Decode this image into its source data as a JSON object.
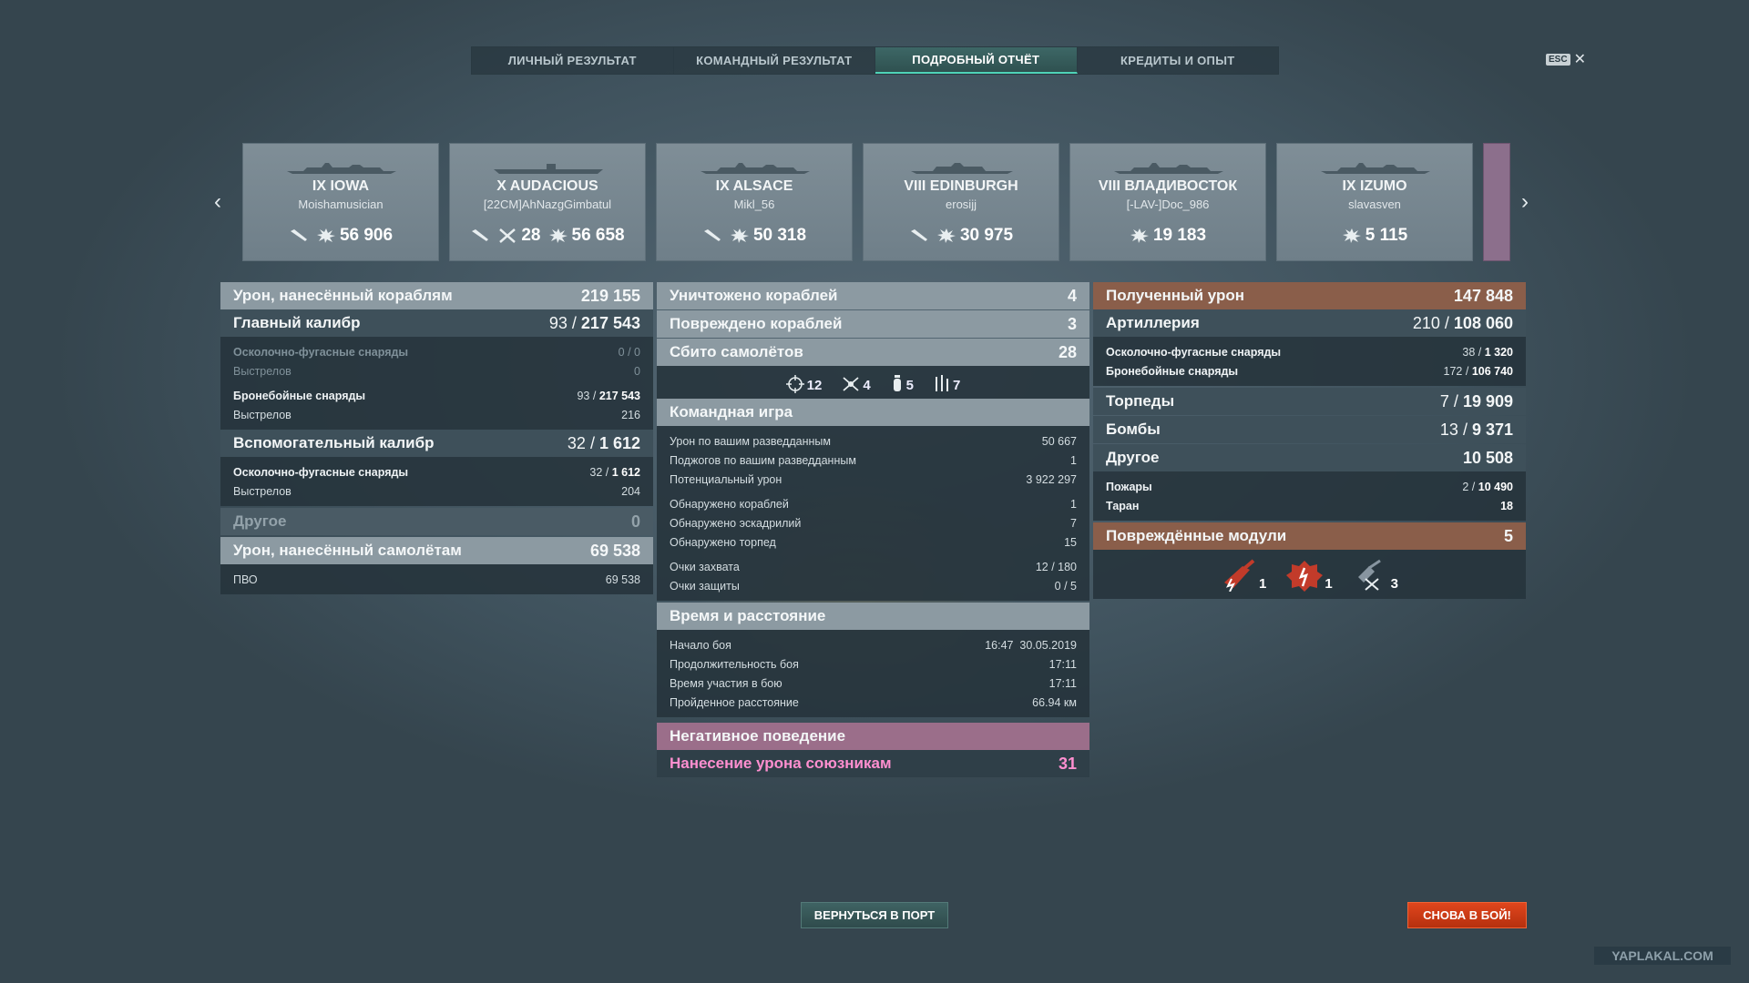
{
  "tabs": [
    {
      "label": "ЛИЧНЫЙ РЕЗУЛЬТАТ"
    },
    {
      "label": "КОМАНДНЫЙ РЕЗУЛЬТАТ"
    },
    {
      "label": "ПОДРОБНЫЙ ОТЧЁТ"
    },
    {
      "label": "КРЕДИТЫ И ОПЫТ"
    }
  ],
  "esc_label": "ESC",
  "ships": [
    {
      "name": "IX IOWA",
      "player": "Moishamusician",
      "kills": "",
      "damage": "56 906"
    },
    {
      "name": "X AUDACIOUS",
      "player": "[22CM]AhNazgGimbatul",
      "kills": "28",
      "damage": "56 658"
    },
    {
      "name": "IX ALSACE",
      "player": "Mikl_56",
      "kills": "",
      "damage": "50 318"
    },
    {
      "name": "VIII EDINBURGH",
      "player": "erosijj",
      "kills": "",
      "damage": "30 975"
    },
    {
      "name": "VIII ВЛАДИВОСТОК",
      "player": "[-LAV-]Doc_986",
      "kills": "",
      "damage": "19 183"
    },
    {
      "name": "IX IZUMO",
      "player": "slavasven",
      "kills": "",
      "damage": "5 115"
    }
  ],
  "left": {
    "ship_damage": {
      "label": "Урон, нанесённый кораблям",
      "value": "219 155"
    },
    "main": {
      "label": "Главный калибр",
      "hits": "93",
      "dmg": "217 543"
    },
    "main_he": {
      "label": "Осколочно-фугасные снаряды",
      "value": "0 / 0"
    },
    "main_he_shots": {
      "label": "Выстрелов",
      "value": "0"
    },
    "main_ap": {
      "label": "Бронебойные снаряды",
      "hits": "93 /",
      "dmg": "217 543"
    },
    "main_ap_shots": {
      "label": "Выстрелов",
      "value": "216"
    },
    "secondary": {
      "label": "Вспомогательный калибр",
      "hits": "32",
      "dmg": "1 612"
    },
    "sec_he": {
      "label": "Осколочно-фугасные снаряды",
      "hits": "32 /",
      "dmg": "1 612"
    },
    "sec_he_shots": {
      "label": "Выстрелов",
      "value": "204"
    },
    "other": {
      "label": "Другое",
      "value": "0"
    },
    "plane_damage": {
      "label": "Урон, нанесённый самолётам",
      "value": "69 538"
    },
    "aa": {
      "label": "ПВО",
      "value": "69 538"
    }
  },
  "center": {
    "destroyed": {
      "label": "Уничтожено кораблей",
      "value": "4"
    },
    "damaged": {
      "label": "Повреждено кораблей",
      "value": "3"
    },
    "planes": {
      "label": "Сбито самолётов",
      "value": "28"
    },
    "plane_types": [
      {
        "icon": "crosshair-icon",
        "value": "12"
      },
      {
        "icon": "fighter-icon",
        "value": "4"
      },
      {
        "icon": "bomb-icon",
        "value": "5"
      },
      {
        "icon": "rocket-icon",
        "value": "7"
      }
    ],
    "team": {
      "label": "Командная игра",
      "lines": [
        {
          "k": "Урон по вашим разведданным",
          "v": "50 667"
        },
        {
          "k": "Поджогов по вашим разведданным",
          "v": "1"
        },
        {
          "k": "Потенциальный урон",
          "v": "3 922 297"
        },
        {
          "k": "Обнаружено кораблей",
          "v": "1"
        },
        {
          "k": "Обнаружено эскадрилий",
          "v": "7"
        },
        {
          "k": "Обнаружено торпед",
          "v": "15"
        },
        {
          "k": "Очки захвата",
          "v": "12 / 180"
        },
        {
          "k": "Очки защиты",
          "v": "0 / 5"
        }
      ]
    },
    "time": {
      "label": "Время и расстояние",
      "lines": [
        {
          "k": "Начало боя",
          "v": "16:47  30.05.2019"
        },
        {
          "k": "Продолжительность боя",
          "v": "17:11"
        },
        {
          "k": "Время участия в бою",
          "v": "17:11"
        },
        {
          "k": "Пройденное расстояние",
          "v": "66.94 км"
        }
      ]
    },
    "negative": {
      "label": "Негативное поведение"
    },
    "ally_damage": {
      "label": "Нанесение урона союзникам",
      "value": "31"
    }
  },
  "right": {
    "received": {
      "label": "Полученный урон",
      "value": "147 848"
    },
    "artillery": {
      "label": "Артиллерия",
      "hits": "210",
      "dmg": "108 060"
    },
    "he": {
      "label": "Осколочно-фугасные снаряды",
      "hits": "38 /",
      "dmg": "1 320"
    },
    "ap": {
      "label": "Бронебойные снаряды",
      "hits": "172 /",
      "dmg": "106 740"
    },
    "torpedoes": {
      "label": "Торпеды",
      "hits": "7",
      "dmg": "19 909"
    },
    "bombs": {
      "label": "Бомбы",
      "hits": "13",
      "dmg": "9 371"
    },
    "other": {
      "label": "Другое",
      "value": "10 508"
    },
    "fires": {
      "label": "Пожары",
      "hits": "2 /",
      "dmg": "10 490"
    },
    "ram": {
      "label": "Таран",
      "value": "18"
    },
    "modules": {
      "label": "Повреждённые модули",
      "value": "5"
    },
    "module_icons": [
      {
        "icon": "gun-damage-icon",
        "value": "1"
      },
      {
        "icon": "engine-damage-icon",
        "value": "1"
      },
      {
        "icon": "aa-damage-icon",
        "value": "3"
      }
    ]
  },
  "buttons": {
    "port": "ВЕРНУТЬСЯ В ПОРТ",
    "fight": "СНОВА В БОЙ!"
  },
  "watermark": "YAPLAKAL.COM"
}
